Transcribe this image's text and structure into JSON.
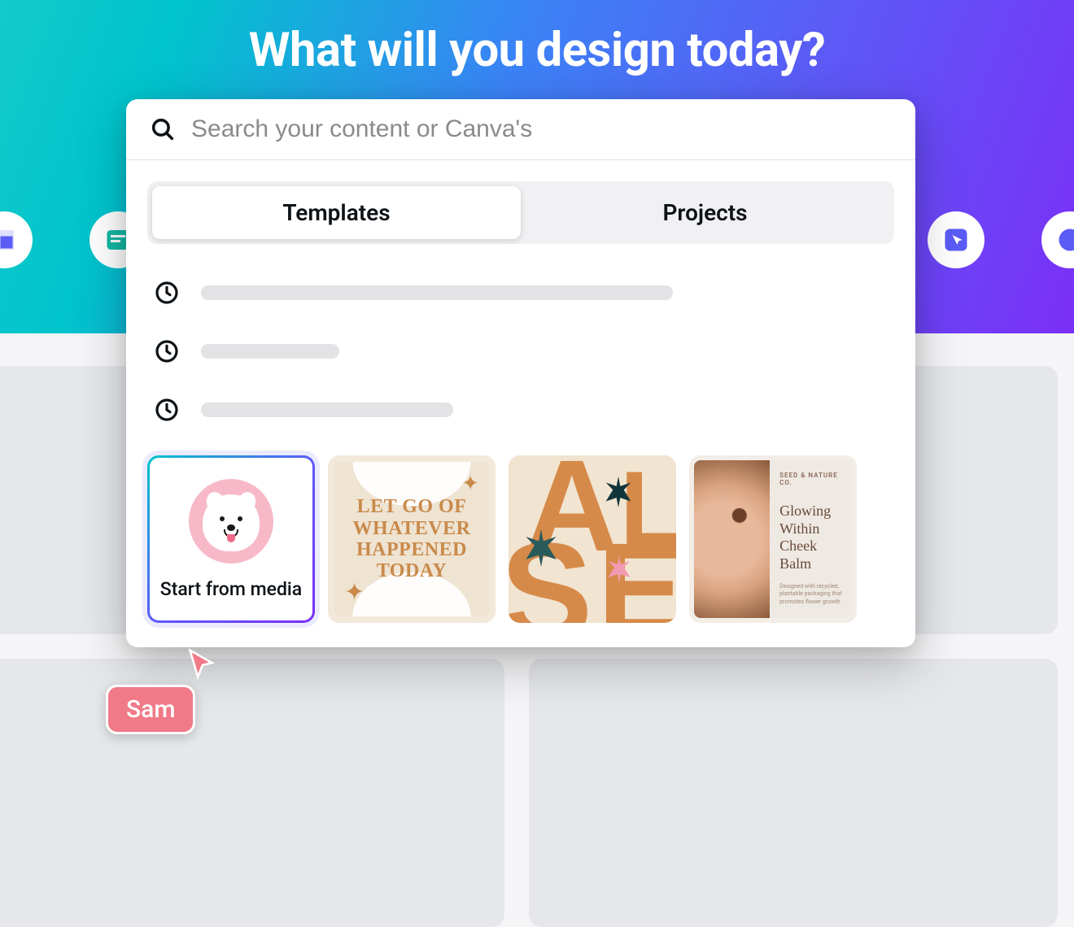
{
  "hero": {
    "title": "What will you design today?"
  },
  "search": {
    "placeholder": "Search your content or Canva's",
    "value": ""
  },
  "tabs": {
    "templates": "Templates",
    "projects": "Projects",
    "active": "templates"
  },
  "cards": {
    "start": {
      "label": "Start from media"
    },
    "quote": {
      "line1": "LET GO OF",
      "line2": "WHATEVER",
      "line3": "HAPPENED",
      "line4": "TODAY"
    },
    "letters": {
      "a": "A",
      "l": "L",
      "s": "S",
      "e": "E"
    },
    "product": {
      "brand": "SEED & NATURE CO.",
      "title": "Glowing Within Cheek Balm",
      "desc": "Designed with recycled, plantable packaging that promotes flower growth."
    }
  },
  "collaborator": {
    "name": "Sam"
  }
}
